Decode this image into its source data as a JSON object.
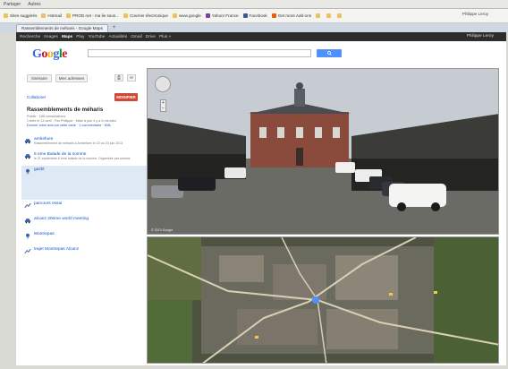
{
  "os_bar": {
    "items": [
      "Partager",
      "Autres"
    ]
  },
  "bookmarks": {
    "items": [
      "Sites suggérés",
      "Hotmail",
      "PROD.net - ma lie sous...",
      "Courrier électronique",
      "www.google",
      "Yahoo! France",
      "Facebook",
      "Get more Add-ons",
      "",
      "",
      ""
    ],
    "right_label": "Philippe Leroy"
  },
  "tabs": {
    "active_label": "Rassemblements de méharis - Google Maps"
  },
  "gbar": {
    "items": [
      "Recherche",
      "Images",
      "Maps",
      "Play",
      "YouTube",
      "Actualités",
      "Gmail",
      "Drive",
      "Plus »"
    ],
    "active_index": 2,
    "user": "Philippe Leroy"
  },
  "logo": "Google",
  "left": {
    "itinerary_button": "Itinéraire",
    "my_addresses_button": "Mes adresses",
    "collab_link": "Collaborer",
    "modify_button": "MODIFIER",
    "map_title": "Rassemblements de méharis",
    "meta_lines": [
      "Public · 166 consultations",
      "Créée le 14 avril · Par Philippe · Mise à jour il y a 6 minutes",
      "Donner votre avis sur cette carte · 1 commentaire · KML"
    ],
    "items": [
      {
        "title": "ambefuen",
        "desc": "Rassemblement de méharis à Ambefuen le 22 au 23 juin 2013",
        "selected": false
      },
      {
        "title": "6 eme  Balade de la somme",
        "desc": "le 21 septembre 6 eme balade de la somme. Organisée par somme",
        "selected": false
      },
      {
        "title": "gazbl",
        "desc": "",
        "selected": true
      },
      {
        "title": "parcours essai",
        "desc": "",
        "selected": false
      },
      {
        "title": "alcanz 20eme world meeting",
        "desc": "",
        "selected": false
      },
      {
        "title": "Montrepas",
        "desc": "",
        "selected": false
      },
      {
        "title": "trajet Montrepas Alcanz",
        "desc": "",
        "selected": false
      }
    ]
  },
  "streetview": {
    "caption": "© 2013 Google"
  },
  "colors": {
    "search_button": "#4d90fe",
    "modify_button": "#d14836",
    "gbar": "#2d2d2d",
    "link": "#1155cc"
  }
}
